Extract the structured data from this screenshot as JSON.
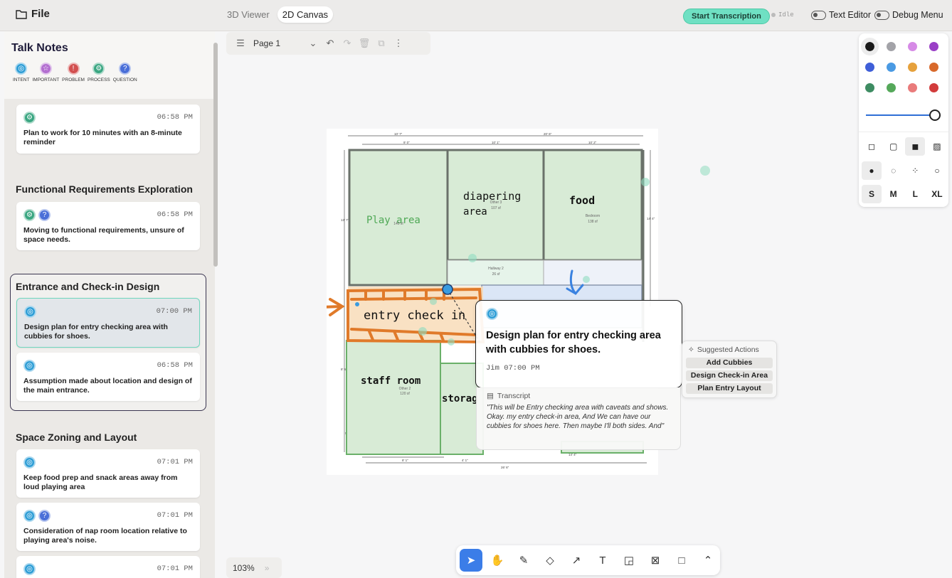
{
  "header": {
    "file_label": "File",
    "tabs": [
      {
        "label": "3D Viewer",
        "active": false
      },
      {
        "label": "2D Canvas",
        "active": true
      }
    ],
    "start_transcription": "Start Transcription",
    "status": "Idle",
    "text_editor": "Text Editor",
    "debug_menu": "Debug Menu"
  },
  "sidebar": {
    "title": "Talk Notes",
    "legend": [
      "INTENT",
      "IMPORTANT",
      "PROBLEM",
      "PROCESS",
      "QUESTION"
    ],
    "notes": [
      {
        "time": "06:58 PM",
        "text": "Plan to work for 10 minutes with an 8-minute reminder",
        "badges": [
          "process"
        ]
      },
      {
        "time": "06:58 PM",
        "text": "Moving to functional requirements, unsure of space needs.",
        "badges": [
          "process",
          "question"
        ]
      },
      {
        "time": "07:00 PM",
        "text": "Design plan for entry checking area with cubbies for shoes.",
        "badges": [
          "intent"
        ]
      },
      {
        "time": "06:58 PM",
        "text": "Assumption made about location and design of the main entrance.",
        "badges": [
          "intent"
        ]
      },
      {
        "time": "07:01 PM",
        "text": "Keep food prep and snack areas away from loud playing area",
        "badges": [
          "intent"
        ]
      },
      {
        "time": "07:01 PM",
        "text": "Consideration of nap room location relative to playing area's noise.",
        "badges": [
          "intent",
          "question"
        ]
      },
      {
        "time": "07:01 PM",
        "text": "",
        "badges": [
          "intent"
        ]
      }
    ],
    "sections": [
      "Functional Requirements Exploration",
      "Entrance and Check-in Design",
      "Space Zoning and Layout"
    ]
  },
  "canvas": {
    "page_label": "Page 1",
    "zoom": "103%",
    "zoom_expand": "»",
    "floorplan": {
      "labels": {
        "play": "Play area",
        "diapering": "diapering",
        "diapering2": "area",
        "food": "food",
        "entry": "entry check in",
        "staff": "staff room",
        "storage": "storag"
      },
      "small": {
        "other3": "Other 3",
        "other3_area": "107 sf",
        "bedroom": "Bedroom",
        "bedroom_area": "138 sf",
        "other1_area": "140 sf",
        "hallway": "Hallway 2",
        "hallway_area": "26 sf",
        "other2": "Other 2",
        "other2_area": "120 sf"
      },
      "dims": {
        "top1": "10' 7\"",
        "top2": "20' 6\"",
        "top3": "9' 0\"",
        "top4": "10' 1\"",
        "top5": "10' 2\"",
        "left1": "13' 7\"",
        "left2": "8' 6\"",
        "left3": "5' 0\"",
        "right1": "14' 4\"",
        "bottom1": "8' 1\"",
        "bottom2": "4' 1\"",
        "bottom3": "14' 4\"",
        "bottom4": "26' 6\""
      }
    }
  },
  "popup": {
    "title": "Design plan for entry checking area with cubbies for shoes.",
    "meta": "Jim 07:00 PM",
    "transcript_label": "Transcript",
    "transcript": "\"This will be Entry checking area with caveats and shows. Okay. my entry check-in area, And We can have our cubbies for shoes here. Then maybe I'll both sides. And\""
  },
  "suggested": {
    "label": "Suggested Actions",
    "actions": [
      "Add Cubbies",
      "Design Check-in Area",
      "Plan Entry Layout"
    ]
  },
  "style_panel": {
    "colors": [
      "#1a1a1a",
      "#a3a3a8",
      "#d68ae6",
      "#9a3fc6",
      "#3f5fd8",
      "#4a9ae3",
      "#e6a13c",
      "#d8692b",
      "#3e8c62",
      "#55a85a",
      "#e97b7b",
      "#d23b3b"
    ],
    "sizes": [
      "S",
      "M",
      "L",
      "XL"
    ],
    "opacity": 1.0
  },
  "toolbar": {
    "tools": [
      "select-icon",
      "hand-icon",
      "pencil-icon",
      "eraser-icon",
      "arrow-icon",
      "text-icon",
      "note-icon",
      "image-icon",
      "rectangle-icon",
      "chevron-up-icon"
    ]
  }
}
